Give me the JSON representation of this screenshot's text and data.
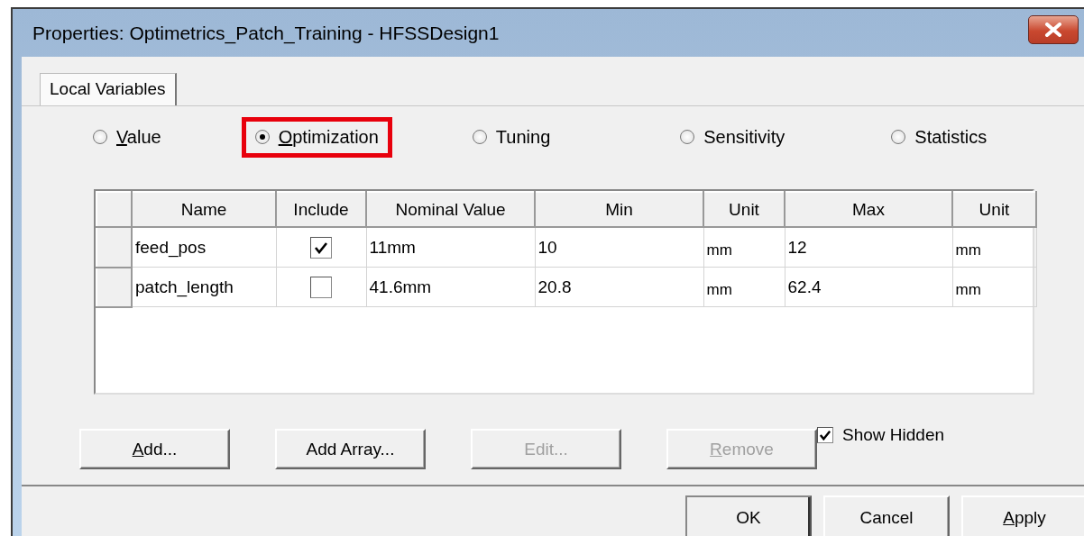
{
  "window": {
    "title": "Properties: Optimetrics_Patch_Training - HFSSDesign1"
  },
  "tabs": [
    {
      "label": "Local Variables",
      "selected": true
    }
  ],
  "modes": [
    {
      "label": "Value",
      "selected": false,
      "mnemonic": true,
      "highlighted": false
    },
    {
      "label": "Optimization",
      "selected": true,
      "mnemonic": true,
      "highlighted": true
    },
    {
      "label": "Tuning",
      "selected": false,
      "mnemonic": false,
      "highlighted": false
    },
    {
      "label": "Sensitivity",
      "selected": false,
      "mnemonic": false,
      "highlighted": false
    },
    {
      "label": "Statistics",
      "selected": false,
      "mnemonic": false,
      "highlighted": false
    }
  ],
  "table": {
    "columns": [
      "Name",
      "Include",
      "Nominal Value",
      "Min",
      "Unit",
      "Max",
      "Unit"
    ],
    "rows": [
      {
        "name": "feed_pos",
        "include": true,
        "nominal": "11mm",
        "min": "10",
        "min_unit": "mm",
        "max": "12",
        "max_unit": "mm"
      },
      {
        "name": "patch_length",
        "include": false,
        "nominal": "41.6mm",
        "min": "20.8",
        "min_unit": "mm",
        "max": "62.4",
        "max_unit": "mm"
      }
    ]
  },
  "actions": [
    {
      "label": "Add...",
      "disabled": false,
      "mnemonic": true
    },
    {
      "label": "Add Array...",
      "disabled": false,
      "mnemonic": false
    },
    {
      "label": "Edit...",
      "disabled": true,
      "mnemonic": false
    },
    {
      "label": "Remove",
      "disabled": true,
      "mnemonic": true
    }
  ],
  "show_hidden": {
    "label": "Show Hidden",
    "checked": true
  },
  "dialog_buttons": [
    {
      "label": "OK",
      "default": true,
      "mnemonic": false
    },
    {
      "label": "Cancel",
      "default": false,
      "mnemonic": false
    },
    {
      "label": "Apply",
      "default": false,
      "mnemonic": true
    }
  ]
}
